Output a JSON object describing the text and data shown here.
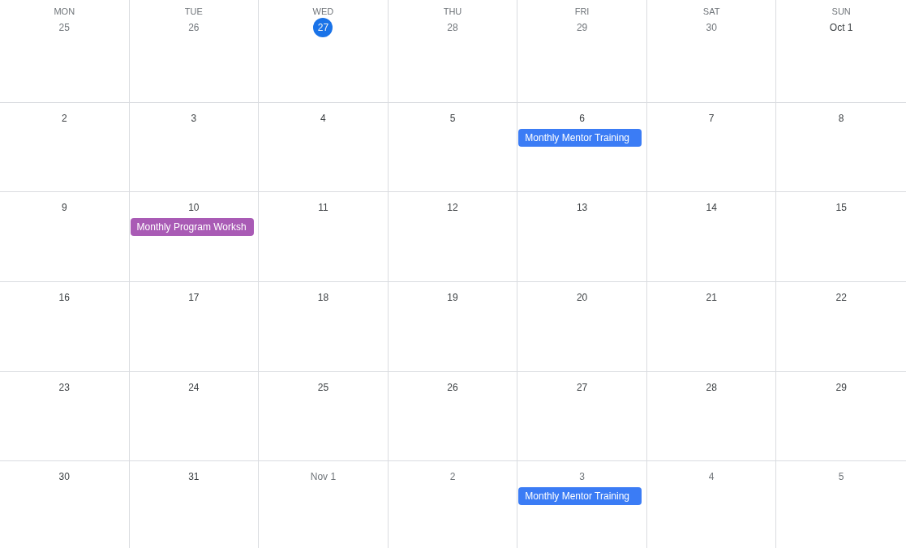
{
  "weekdays": [
    "MON",
    "TUE",
    "WED",
    "THU",
    "FRI",
    "SAT",
    "SUN"
  ],
  "weeks": [
    {
      "days": [
        {
          "date": "25",
          "in_month": false,
          "today": false
        },
        {
          "date": "26",
          "in_month": false,
          "today": false
        },
        {
          "date": "27",
          "in_month": false,
          "today": true
        },
        {
          "date": "28",
          "in_month": false,
          "today": false
        },
        {
          "date": "29",
          "in_month": false,
          "today": false
        },
        {
          "date": "30",
          "in_month": false,
          "today": false
        },
        {
          "date": "Oct 1",
          "in_month": true,
          "today": false
        }
      ]
    },
    {
      "days": [
        {
          "date": "2",
          "in_month": true,
          "today": false
        },
        {
          "date": "3",
          "in_month": true,
          "today": false
        },
        {
          "date": "4",
          "in_month": true,
          "today": false
        },
        {
          "date": "5",
          "in_month": true,
          "today": false
        },
        {
          "date": "6",
          "in_month": true,
          "today": false,
          "events": [
            {
              "title": "Monthly Mentor Training",
              "color": "#3b7cf5"
            }
          ]
        },
        {
          "date": "7",
          "in_month": true,
          "today": false
        },
        {
          "date": "8",
          "in_month": true,
          "today": false
        }
      ]
    },
    {
      "days": [
        {
          "date": "9",
          "in_month": true,
          "today": false
        },
        {
          "date": "10",
          "in_month": true,
          "today": false,
          "events": [
            {
              "title": "Monthly Program Worksh",
              "color": "#a95bb5"
            }
          ]
        },
        {
          "date": "11",
          "in_month": true,
          "today": false
        },
        {
          "date": "12",
          "in_month": true,
          "today": false
        },
        {
          "date": "13",
          "in_month": true,
          "today": false
        },
        {
          "date": "14",
          "in_month": true,
          "today": false
        },
        {
          "date": "15",
          "in_month": true,
          "today": false
        }
      ]
    },
    {
      "days": [
        {
          "date": "16",
          "in_month": true,
          "today": false
        },
        {
          "date": "17",
          "in_month": true,
          "today": false
        },
        {
          "date": "18",
          "in_month": true,
          "today": false
        },
        {
          "date": "19",
          "in_month": true,
          "today": false
        },
        {
          "date": "20",
          "in_month": true,
          "today": false
        },
        {
          "date": "21",
          "in_month": true,
          "today": false
        },
        {
          "date": "22",
          "in_month": true,
          "today": false
        }
      ]
    },
    {
      "days": [
        {
          "date": "23",
          "in_month": true,
          "today": false
        },
        {
          "date": "24",
          "in_month": true,
          "today": false
        },
        {
          "date": "25",
          "in_month": true,
          "today": false
        },
        {
          "date": "26",
          "in_month": true,
          "today": false
        },
        {
          "date": "27",
          "in_month": true,
          "today": false
        },
        {
          "date": "28",
          "in_month": true,
          "today": false
        },
        {
          "date": "29",
          "in_month": true,
          "today": false
        }
      ]
    },
    {
      "days": [
        {
          "date": "30",
          "in_month": true,
          "today": false
        },
        {
          "date": "31",
          "in_month": true,
          "today": false
        },
        {
          "date": "Nov 1",
          "in_month": false,
          "today": false
        },
        {
          "date": "2",
          "in_month": false,
          "today": false
        },
        {
          "date": "3",
          "in_month": false,
          "today": false,
          "events": [
            {
              "title": "Monthly Mentor Training",
              "color": "#3b7cf5"
            }
          ]
        },
        {
          "date": "4",
          "in_month": false,
          "today": false
        },
        {
          "date": "5",
          "in_month": false,
          "today": false
        }
      ]
    }
  ]
}
